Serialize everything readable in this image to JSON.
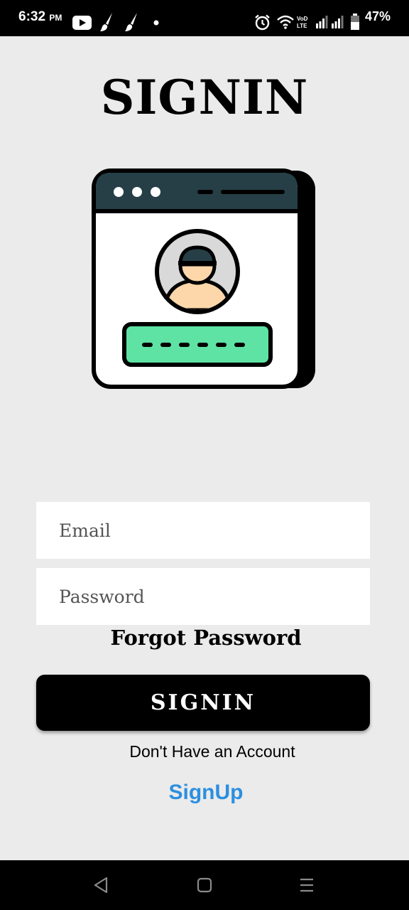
{
  "status_bar": {
    "time": "6:32",
    "ampm": "PM",
    "battery_percent": "47%",
    "icons": [
      "youtube-icon",
      "brush-icon",
      "brush-icon",
      "dot-icon",
      "alarm-icon",
      "wifi-icon",
      "volte-icon",
      "signal-icon",
      "signal-icon",
      "battery-icon"
    ]
  },
  "header": {
    "title": "SIGNIN"
  },
  "illustration": {
    "icon": "login-window-illustration",
    "colors": {
      "titlebar": "#263f47",
      "password_box": "#5ee3a4",
      "face": "#fdd7aa",
      "avatar_bg": "#d9d9d9"
    }
  },
  "form": {
    "email_placeholder": "Email",
    "email_value": "",
    "password_placeholder": "Password",
    "password_value": "",
    "forgot_label": "Forgot Password",
    "signin_label": "SIGNIN",
    "no_account_text": "Don't Have an Account",
    "signup_label": "SignUp"
  },
  "colors": {
    "background": "#ebebeb",
    "button": "#000000",
    "link": "#2d8fe0"
  },
  "nav_bar": {
    "icons": [
      "back-icon",
      "home-icon",
      "menu-icon"
    ]
  }
}
